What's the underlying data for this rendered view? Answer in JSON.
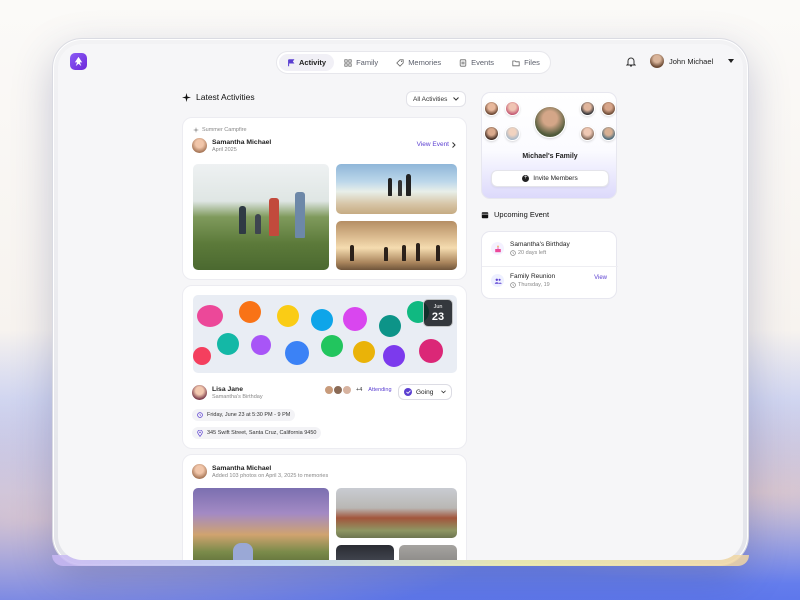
{
  "nav": {
    "tabs": [
      {
        "label": "Activity",
        "icon": "flag-icon",
        "active": true
      },
      {
        "label": "Family",
        "icon": "grid-icon"
      },
      {
        "label": "Memories",
        "icon": "tag-icon"
      },
      {
        "label": "Events",
        "icon": "list-icon"
      },
      {
        "label": "Files",
        "icon": "folder-icon"
      }
    ],
    "user_name": "John Michael"
  },
  "feed": {
    "title": "Latest Activities",
    "filter": "All Activities",
    "post1": {
      "context": "Summer Campfire",
      "author": "Samantha Michael",
      "date": "April 2025",
      "action": "View Event"
    },
    "post2": {
      "date_month": "Jun",
      "date_day": "23",
      "author": "Lisa Jane",
      "subtitle": "Samantha's Birthday",
      "attendees_extra": "+4",
      "attending_label": "Attending",
      "rsvp": "Going",
      "time": "Friday, June 23 at 5:30 PM - 9 PM",
      "location": "345 Swift Street, Santa Cruz, California 9450"
    },
    "post3": {
      "author": "Samantha Michael",
      "subtitle": "Added 103 photos on April 3, 2025 to memories"
    }
  },
  "family": {
    "name": "Michael's Family",
    "invite_label": "Invite Members"
  },
  "upcoming": {
    "title": "Upcoming Event",
    "events": [
      {
        "name": "Samantha's Birthday",
        "meta": "20 days left"
      },
      {
        "name": "Family Reunion",
        "meta": "Thursday, 19",
        "action": "View"
      }
    ]
  },
  "colors": {
    "accent": "#5b3fd1",
    "logo": "#7c3aed"
  }
}
